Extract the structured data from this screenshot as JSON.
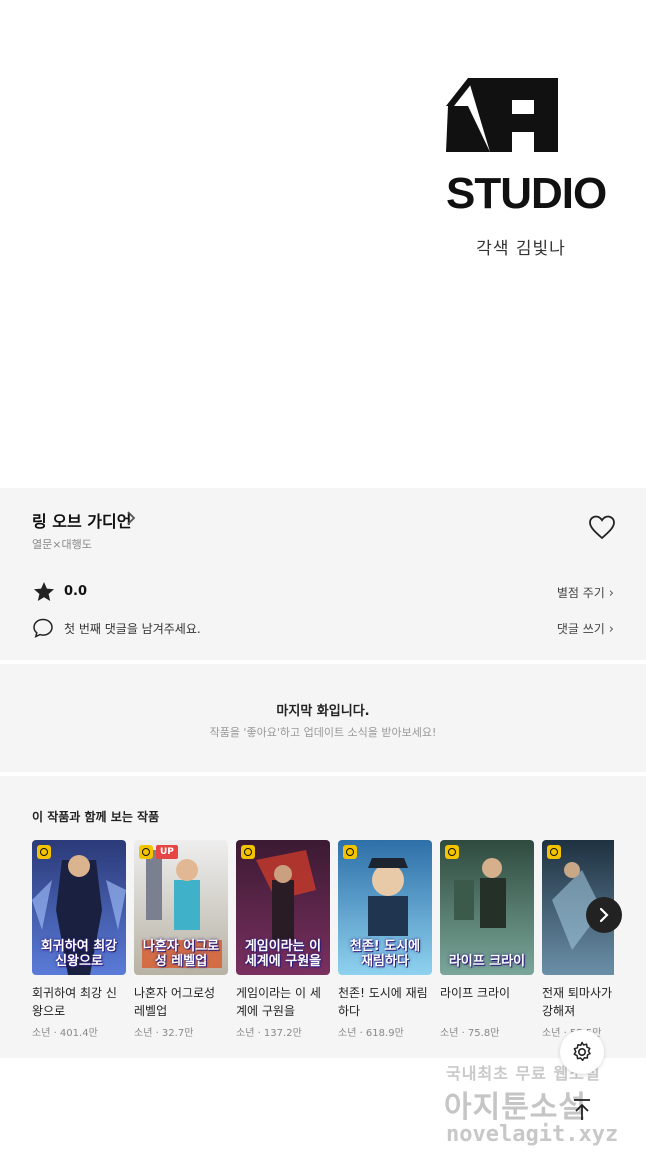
{
  "studio": {
    "logo_text": "STUDIO",
    "credit": "각색 김빛나"
  },
  "series": {
    "title": "링 오브 가디언",
    "authors": "열문×대행도",
    "rating": "0.0",
    "rate_label": "별점 주기",
    "comment_prompt": "첫 번째 댓글을 남겨주세요.",
    "comment_label": "댓글 쓰기"
  },
  "last_episode": {
    "title": "마지막 화입니다.",
    "subtitle": "작품을 '좋아요'하고 업데이트 소식을 받아보세요!"
  },
  "recommendations": {
    "title": "이 작품과 함께 보는 작품",
    "items": [
      {
        "name": "회귀하여 최강 신왕으로",
        "meta": "소년 · 401.4만",
        "cover_text": "회귀하여 최강 신왕으로",
        "badge_up": "",
        "colors": [
          "#2b3a78",
          "#5a7bd8"
        ]
      },
      {
        "name": "나혼자 어그로성 레벨업",
        "meta": "소년 · 32.7만",
        "cover_text": "나혼자 어그로성 레벨업",
        "badge_up": "UP",
        "colors": [
          "#dcdcdc",
          "#b7b2a4"
        ]
      },
      {
        "name": "게임이라는 이 세계에 구원을",
        "meta": "소년 · 137.2만",
        "cover_text": "게임이라는 이 세계에 구원을",
        "badge_up": "",
        "colors": [
          "#3b1a32",
          "#7a3060"
        ]
      },
      {
        "name": "천존! 도시에 재림하다",
        "meta": "소년 · 618.9만",
        "cover_text": "천존! 도시에 재림하다",
        "badge_up": "",
        "colors": [
          "#2e6fa8",
          "#8fd2ef"
        ]
      },
      {
        "name": "라이프 크라이",
        "meta": "소년 · 75.8만",
        "cover_text": "라이프 크라이",
        "badge_up": "",
        "colors": [
          "#2f4a3e",
          "#7aa79a"
        ]
      },
      {
        "name": "전재 퇴마사가 꾸 강해져",
        "meta": "소년 · 55.5만",
        "cover_text": "",
        "badge_up": "",
        "colors": [
          "#1e3140",
          "#6b8fa8"
        ]
      }
    ]
  },
  "watermark": {
    "line1": "국내최초 무료 웹소설",
    "line2": "아지툰소설",
    "line3": "novelagit.xyz"
  },
  "icons": {
    "heart": "heart-icon",
    "star": "star-icon",
    "comment": "comment-icon",
    "next": "chevron-right-icon",
    "settings": "gear-icon",
    "top": "arrow-up-icon"
  },
  "colors": {
    "badge": "#f4c300",
    "up_badge": "#e64545",
    "panel_bg": "#f5f5f5"
  }
}
